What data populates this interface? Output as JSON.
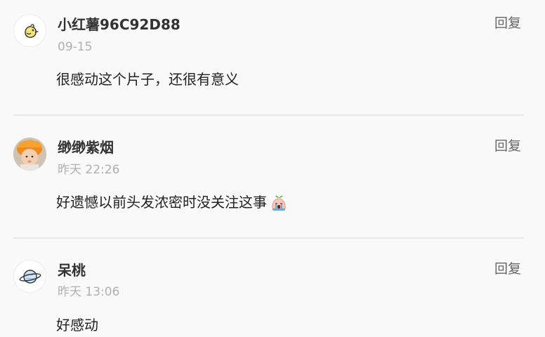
{
  "comments": [
    {
      "username": "小红薯96C92D88",
      "timestamp": "09-15",
      "text": "很感动这个片子，还很有意义",
      "reply_label": "回复",
      "avatar_icon": "chick-icon"
    },
    {
      "username": "缈缈紫烟",
      "timestamp": "昨天 22:26",
      "text": "好遗憾以前头发浓密时没关注这事",
      "reply_label": "回复",
      "avatar_icon": "child-photo",
      "emoji_icon": "crying-sprout-emoji"
    },
    {
      "username": "呆桃",
      "timestamp": "昨天 13:06",
      "text": "好感动",
      "reply_label": "回复",
      "avatar_icon": "planet-icon"
    }
  ]
}
